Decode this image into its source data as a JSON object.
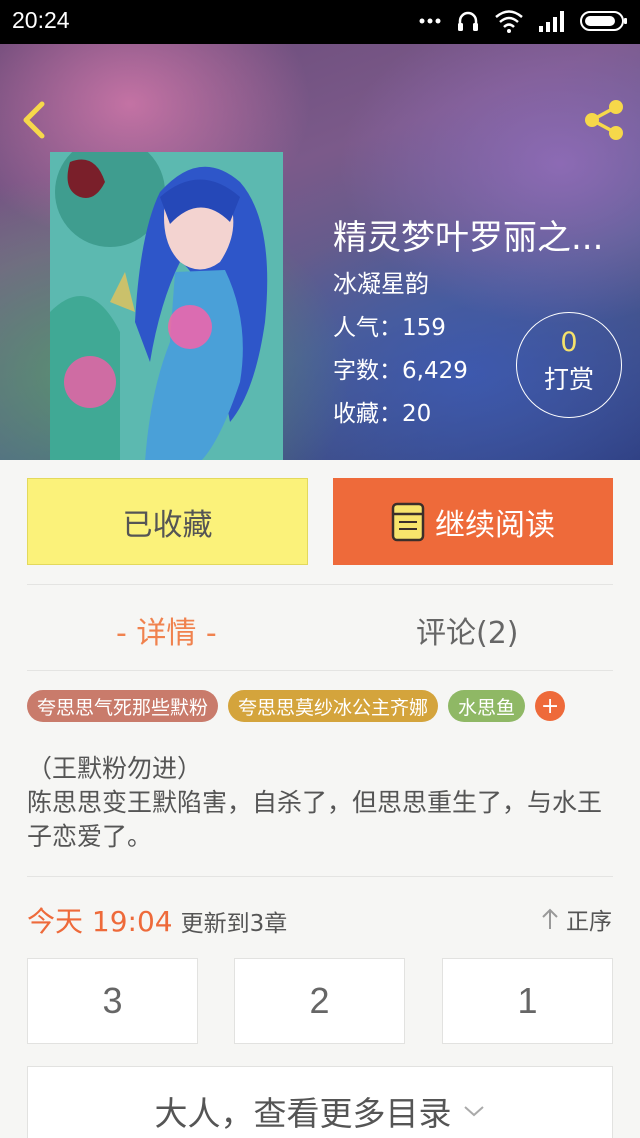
{
  "status_bar": {
    "time": "20:24"
  },
  "book": {
    "title": "精灵梦叶罗丽之...",
    "author": "冰凝星韵",
    "popularity": "人气：159",
    "word_count": "字数：6,429",
    "favorites": "收藏：20"
  },
  "reward": {
    "count": "0",
    "label": "打赏"
  },
  "actions": {
    "collected_label": "已收藏",
    "continue_label": "继续阅读"
  },
  "tabs": {
    "detail": "- 详情 -",
    "comments": "评论(2)"
  },
  "tags": [
    {
      "label": "夸思思气死那些默粉",
      "color": "#c97b6b"
    },
    {
      "label": "夸思思莫纱冰公主齐娜",
      "color": "#d4a43c"
    },
    {
      "label": "水思鱼",
      "color": "#8fb865"
    }
  ],
  "tag_add": "+",
  "description": "（王默粉勿进）\n陈思思变王默陷害，自杀了，但思思重生了，与水王子恋爱了。",
  "update": {
    "time": "今天 19:04",
    "text": "更新到3章"
  },
  "order_label": "正序",
  "chapters": [
    "3",
    "2",
    "1"
  ],
  "more_label": "大人，查看更多目录",
  "colors": {
    "accent": "#ee6a3a",
    "collected_bg": "#fbf27a",
    "reward_num": "#f5e26b"
  }
}
